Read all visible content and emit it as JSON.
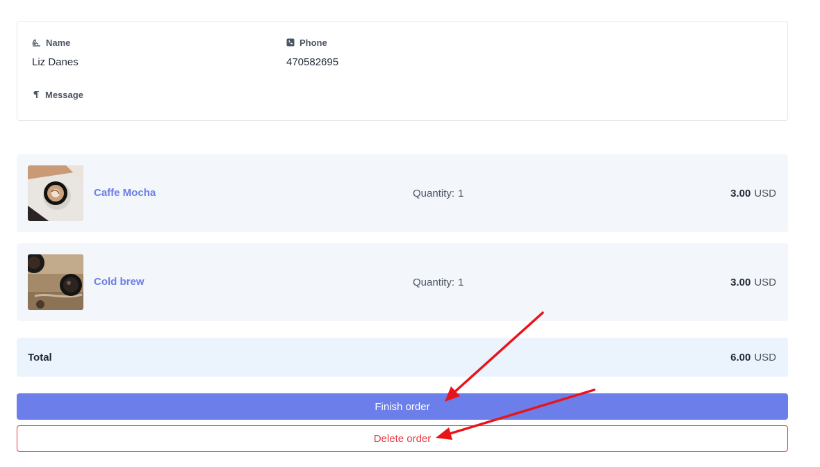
{
  "customer": {
    "name_label": "Name",
    "name_value": "Liz Danes",
    "phone_label": "Phone",
    "phone_value": "470582695",
    "message_label": "Message",
    "message_value": ""
  },
  "items": [
    {
      "name": "Caffe Mocha",
      "quantity_label": "Quantity:",
      "quantity": "1",
      "price": "3.00",
      "currency": "USD",
      "image": "coffee-cup-top-view"
    },
    {
      "name": "Cold brew",
      "quantity_label": "Quantity:",
      "quantity": "1",
      "price": "3.00",
      "currency": "USD",
      "image": "coffee-glasses-on-table"
    }
  ],
  "total": {
    "label": "Total",
    "price": "6.00",
    "currency": "USD"
  },
  "actions": {
    "finish_label": "Finish order",
    "delete_label": "Delete order"
  },
  "icons": {
    "name": "signature-icon",
    "phone": "phone-square-icon",
    "message": "paragraph-icon"
  },
  "colors": {
    "accent": "#6b7ee9",
    "link": "#6b7ee6",
    "danger": "#e53a45",
    "annotation_arrow": "#e8141a",
    "item_bg": "#f3f6fa",
    "total_bg": "#ebf3fd"
  }
}
